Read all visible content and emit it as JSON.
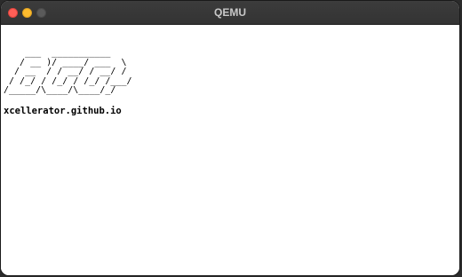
{
  "window": {
    "title": "QEMU"
  },
  "screen": {
    "logo_ascii": "    ___  ___________\n   / __ )/ ____/ ___  \\\n  / __  / / __/ / __/ /\n / /_/ / /_/ / /_/ /___/\n/_____/\\____/\\____/_/",
    "url": "xcellerator.github.io"
  }
}
